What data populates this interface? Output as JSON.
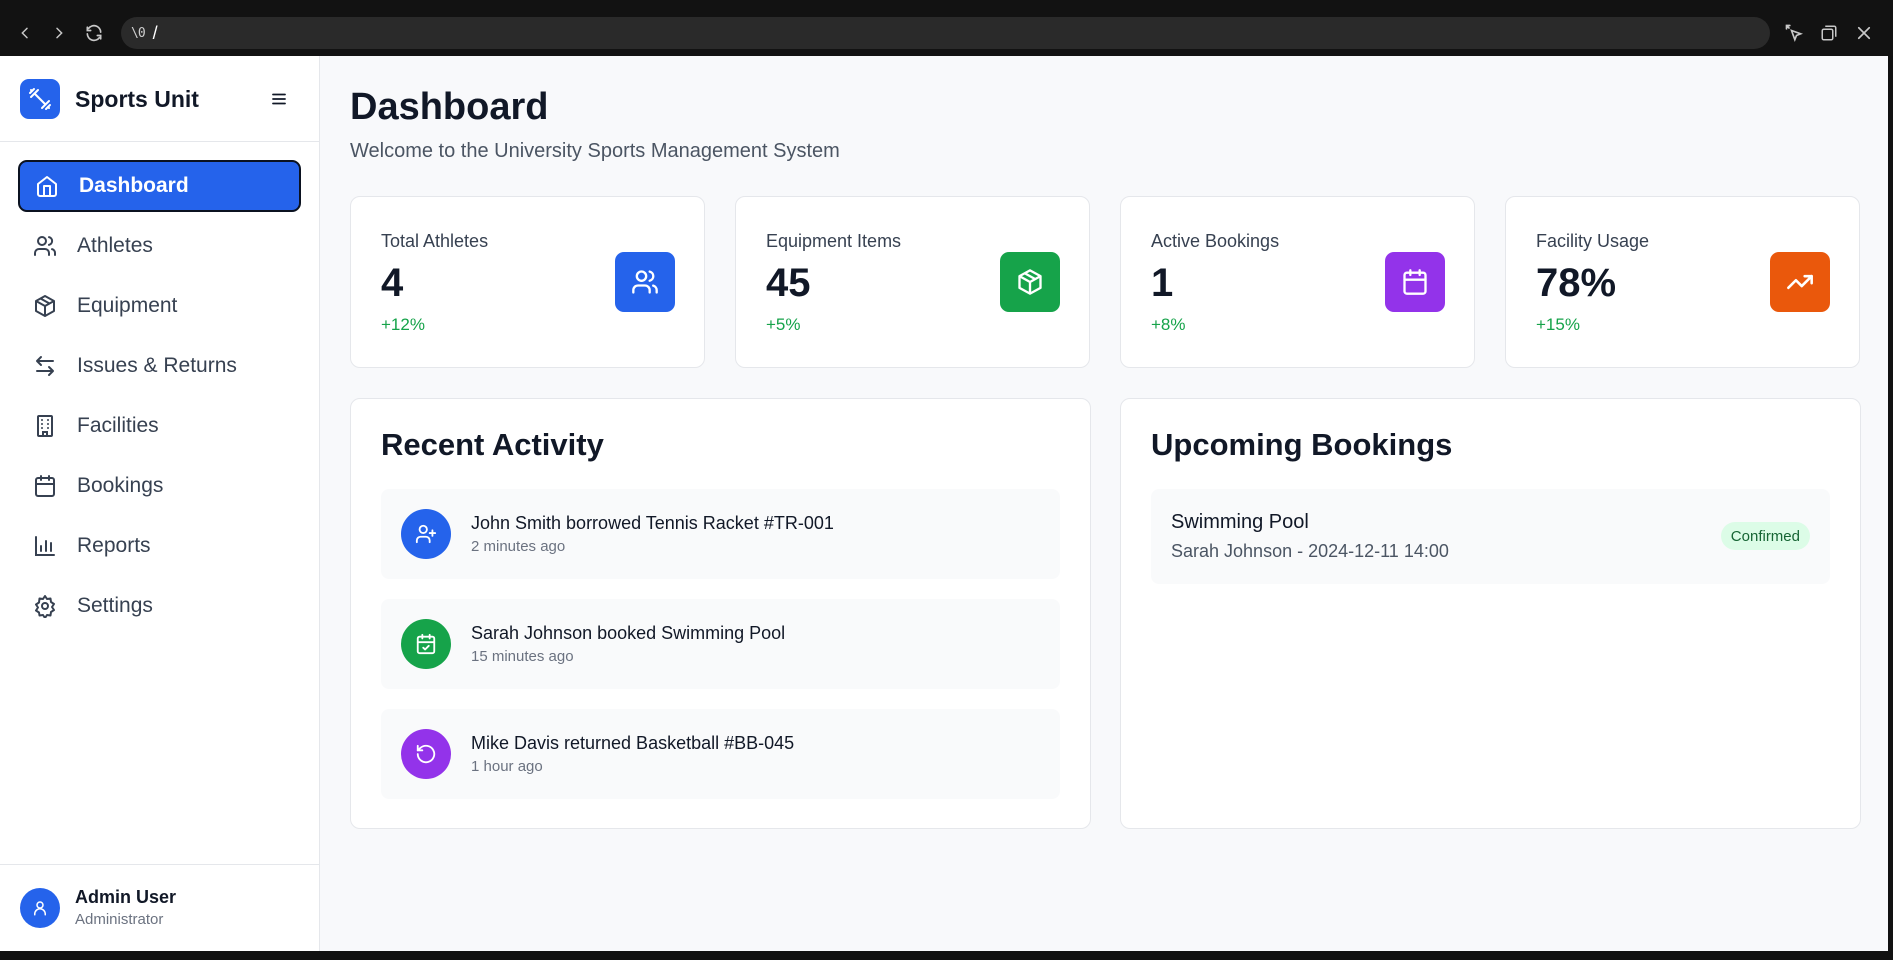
{
  "browser": {
    "address_icon": "\\0",
    "url": "/"
  },
  "app": {
    "name": "Sports Unit"
  },
  "sidebar": {
    "items": [
      {
        "label": "Dashboard",
        "icon": "home-icon",
        "active": true
      },
      {
        "label": "Athletes",
        "icon": "users-icon"
      },
      {
        "label": "Equipment",
        "icon": "package-icon"
      },
      {
        "label": "Issues & Returns",
        "icon": "arrows-swap-icon"
      },
      {
        "label": "Facilities",
        "icon": "building-icon"
      },
      {
        "label": "Bookings",
        "icon": "calendar-icon"
      },
      {
        "label": "Reports",
        "icon": "bar-chart-icon"
      },
      {
        "label": "Settings",
        "icon": "gear-icon"
      }
    ]
  },
  "user": {
    "name": "Admin User",
    "role": "Administrator"
  },
  "page": {
    "title": "Dashboard",
    "subtitle": "Welcome to the University Sports Management System"
  },
  "stats": [
    {
      "label": "Total Athletes",
      "value": "4",
      "change": "+12%",
      "icon": "users-icon",
      "color": "#2563eb"
    },
    {
      "label": "Equipment Items",
      "value": "45",
      "change": "+5%",
      "icon": "package-icon",
      "color": "#16a34a"
    },
    {
      "label": "Active Bookings",
      "value": "1",
      "change": "+8%",
      "icon": "calendar-icon",
      "color": "#9333ea"
    },
    {
      "label": "Facility Usage",
      "value": "78%",
      "change": "+15%",
      "icon": "trending-up-icon",
      "color": "#ea580c"
    }
  ],
  "recent_activity": {
    "title": "Recent Activity",
    "items": [
      {
        "text": "John Smith borrowed Tennis Racket #TR-001",
        "time": "2 minutes ago",
        "icon": "user-plus-icon",
        "color": "#2563eb"
      },
      {
        "text": "Sarah Johnson booked Swimming Pool",
        "time": "15 minutes ago",
        "icon": "calendar-check-icon",
        "color": "#16a34a"
      },
      {
        "text": "Mike Davis returned Basketball #BB-045",
        "time": "1 hour ago",
        "icon": "rotate-ccw-icon",
        "color": "#9333ea"
      }
    ]
  },
  "upcoming_bookings": {
    "title": "Upcoming Bookings",
    "items": [
      {
        "facility": "Swimming Pool",
        "details": "Sarah Johnson - 2024-12-11 14:00",
        "status": "Confirmed"
      }
    ]
  }
}
